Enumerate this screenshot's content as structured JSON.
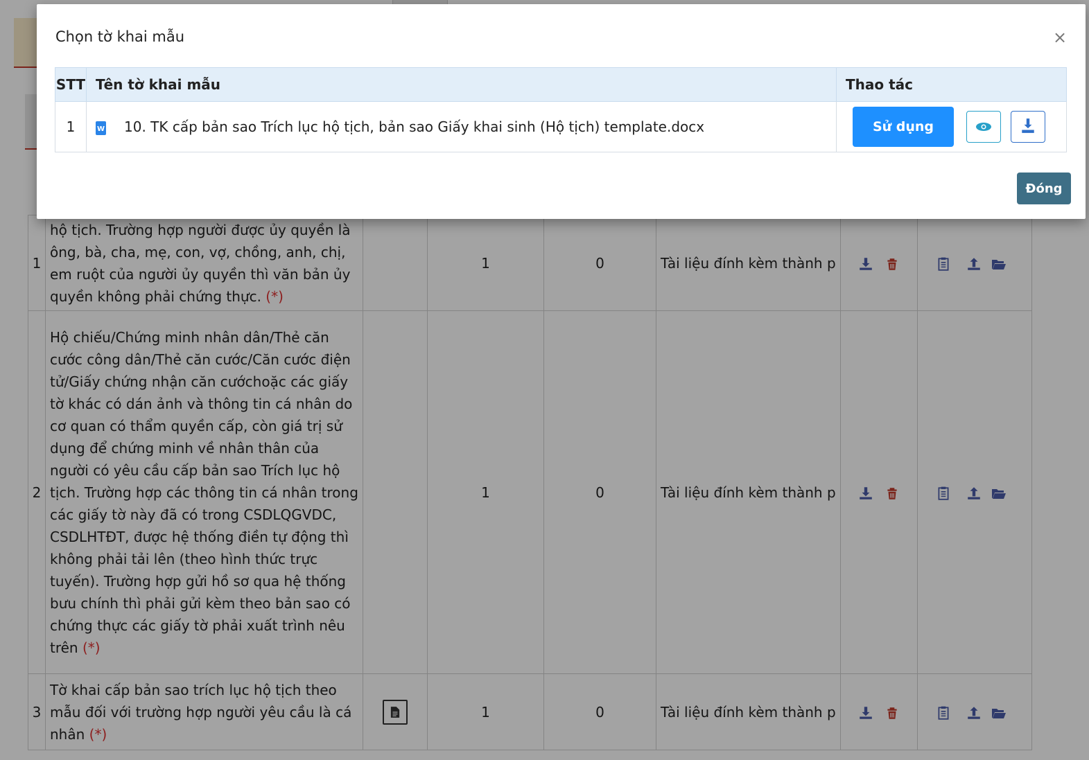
{
  "modal": {
    "title": "Chọn tờ khai mẫu",
    "close_symbol": "×",
    "columns": [
      "STT",
      "Tên tờ khai mẫu",
      "Thao tác"
    ],
    "rows": [
      {
        "stt": "1",
        "file_icon": "word-doc-icon",
        "name": "10. TK cấp bản sao Trích lục hộ tịch, bản sao Giấy khai sinh (Hộ tịch) template.docx",
        "use_label": "Sử dụng",
        "preview_icon": "eye-icon",
        "download_icon": "download-icon"
      }
    ],
    "close_label": "Đóng"
  },
  "background_table": {
    "rows": [
      {
        "stt": "1",
        "text": "hộ tịch. Trường hợp người được ủy quyền là ông, bà, cha, mẹ, con, vợ, chồng, anh, chị, em ruột của người ủy quyền thì văn bản ủy quyền không phải chứng thực.",
        "required": "(*)",
        "copies": "1",
        "attached": "0",
        "file_label": "Tài liệu đính kèm thành p"
      },
      {
        "stt": "2",
        "text": "Hộ chiếu/Chứng minh nhân dân/Thẻ căn cước công dân/Thẻ căn cước/Căn cước điện tử/Giấy chứng nhận căn cướchoặc các giấy tờ khác có dán ảnh và thông tin cá nhân do cơ quan có thẩm quyền cấp, còn giá trị sử dụng để chứng minh về nhân thân của người có yêu cầu cấp bản sao Trích lục hộ tịch. Trường hợp các thông tin cá nhân trong các giấy tờ này đã có trong CSDLQGVDC, CSDLHTĐT, được hệ thống điền tự động thì không phải tải lên (theo hình thức trực tuyến). Trường hợp gửi hồ sơ qua hệ thống bưu chính thì phải gửi kèm theo bản sao có chứng thực các giấy tờ phải xuất trình nêu trên",
        "required": "(*)",
        "copies": "1",
        "attached": "0",
        "file_label": "Tài liệu đính kèm thành p"
      },
      {
        "stt": "3",
        "text": "Tờ khai cấp bản sao trích lục hộ tịch theo mẫu đối với trường hợp người yêu cầu là cá nhân",
        "required": "(*)",
        "copies": "1",
        "attached": "0",
        "file_label": "Tài liệu đính kèm thành p"
      }
    ],
    "row_icons": [
      "download-icon",
      "trash-icon",
      "clipboard-icon",
      "upload-icon",
      "folder-open-icon"
    ],
    "template_icon": "document-icon"
  },
  "colors": {
    "primary": "#1e90ff",
    "close_button": "#3e6f86",
    "header_bg": "#e2eef9",
    "action_icon": "#4a5ca8",
    "delete_icon": "#c0392b"
  }
}
